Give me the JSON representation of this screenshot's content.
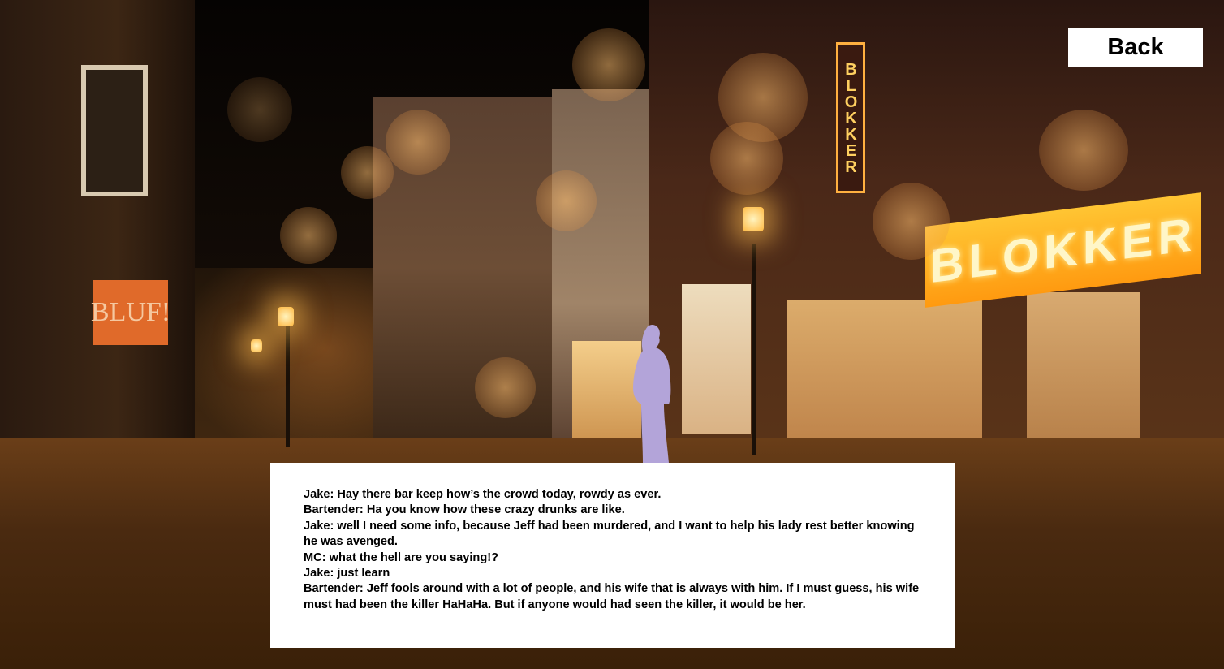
{
  "back_button": {
    "label": "Back"
  },
  "scene": {
    "signs": {
      "blokker": "BLOKKER",
      "bluf": "BLUF!"
    }
  },
  "dialog": {
    "lines": [
      "Jake: Hay there bar keep how’s the crowd today, rowdy as ever.",
      "Bartender: Ha you know how these crazy drunks are like.",
      "Jake: well I need some info, because Jeff had been murdered, and I want to help his lady rest better knowing he was avenged.",
      "MC: what the hell are you saying!?",
      "Jake: just learn",
      "Bartender: Jeff fools around with a lot of people, and his wife that is always with him. If I must guess, his wife must had been the killer HaHaHa. But if anyone would had seen the killer, it would be her."
    ]
  },
  "colors": {
    "dialog_background": "#ffffff",
    "button_background": "#ffffff",
    "text": "#000000",
    "silhouette": "#b3a4d9"
  }
}
